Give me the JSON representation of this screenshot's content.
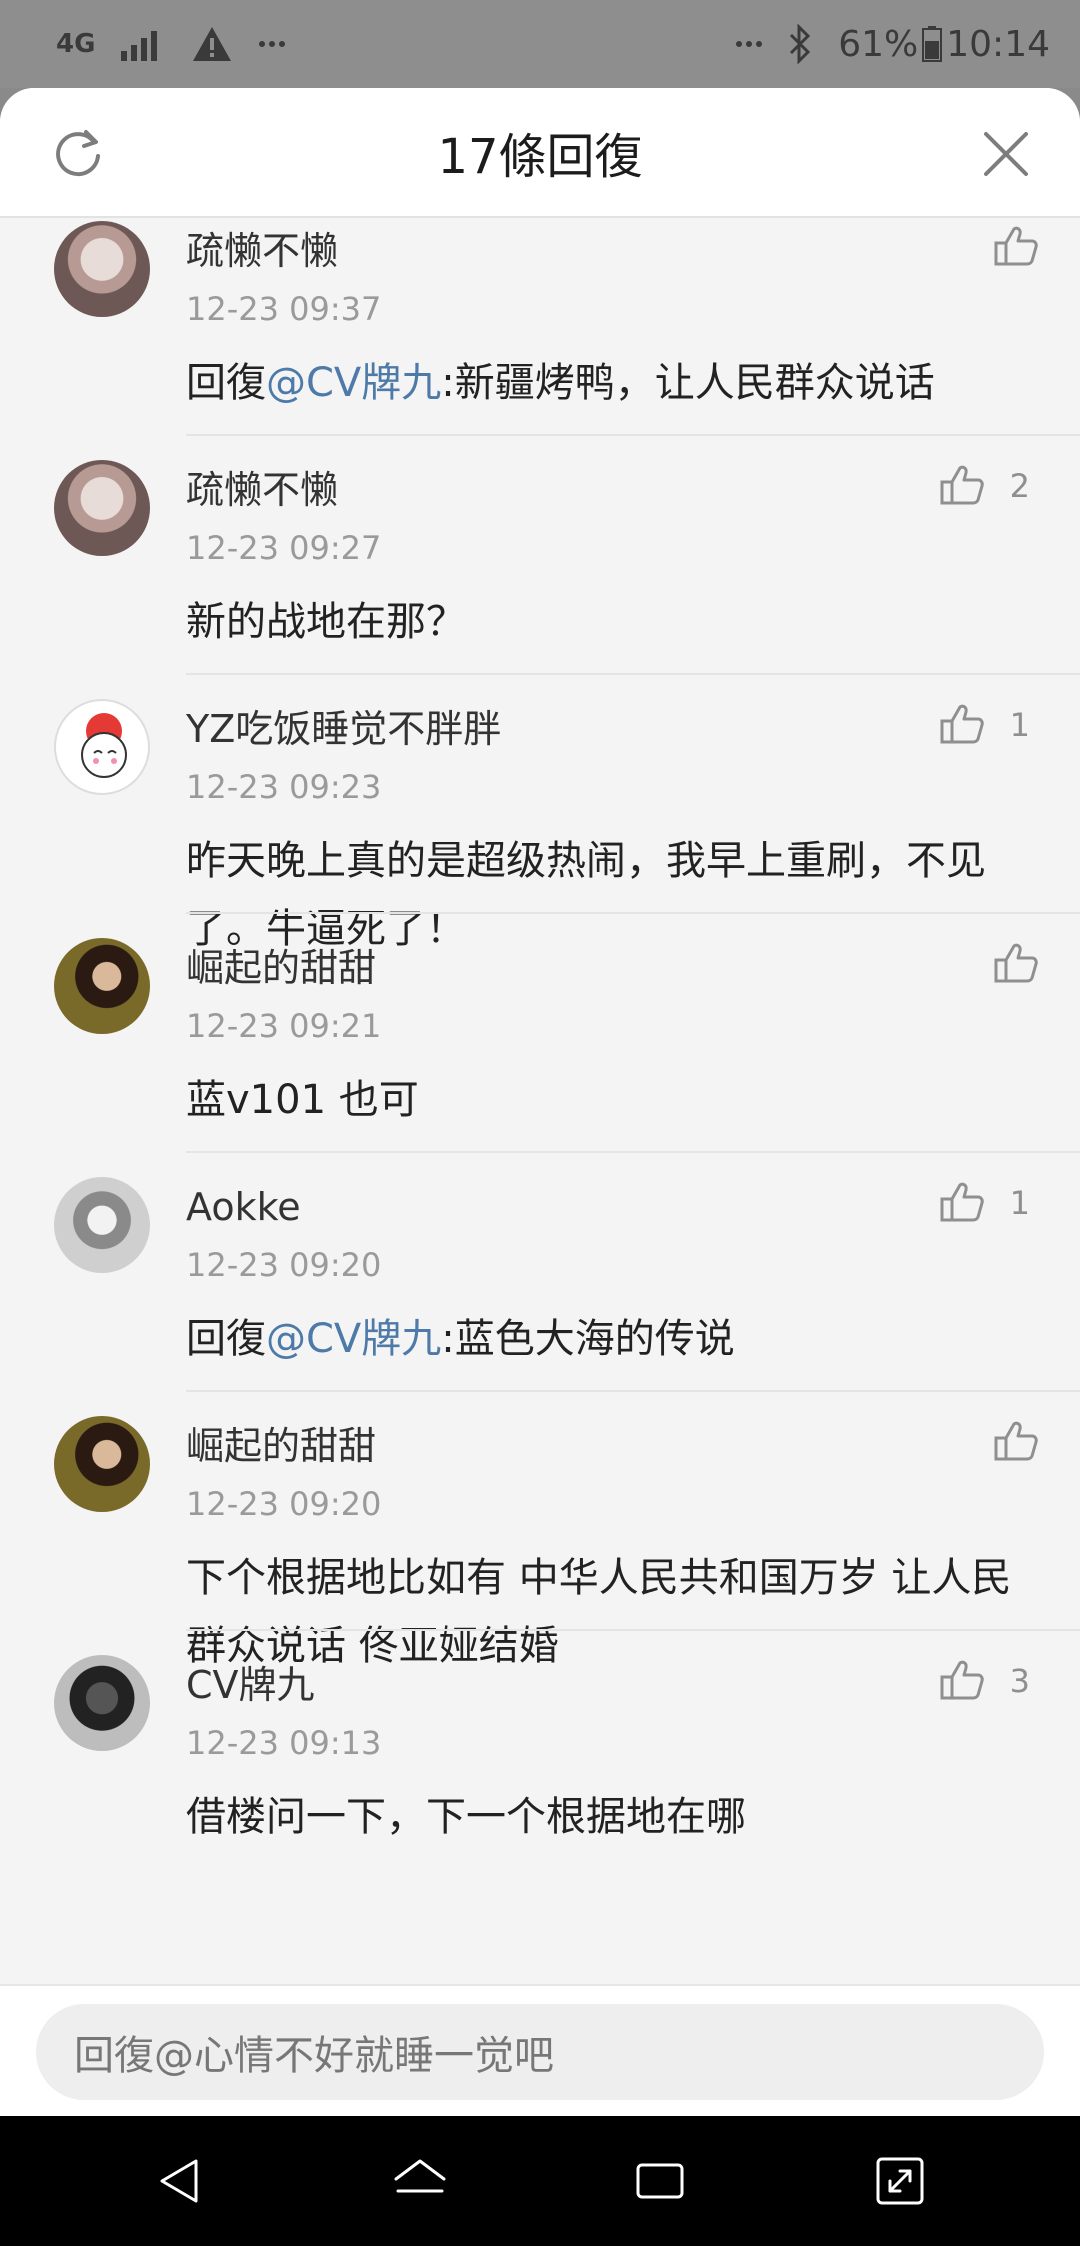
{
  "status_bar": {
    "network": "4G",
    "battery": "61%",
    "time": "10:14",
    "icons": [
      "signal-icon",
      "warning-icon",
      "more-icon",
      "bluetooth-icon",
      "battery-icon"
    ]
  },
  "header": {
    "title": "17條回復",
    "refresh_icon": "refresh-icon",
    "close_icon": "close-icon"
  },
  "comments": [
    {
      "user": "疏懒不懒",
      "time": "12-23 09:37",
      "reply_prefix": "回復",
      "mention": "@CV牌九",
      "text": ":新疆烤鸭，让人民群众说话",
      "likes": ""
    },
    {
      "user": "疏懒不懒",
      "time": "12-23 09:27",
      "reply_prefix": "",
      "mention": "",
      "text": "新的战地在那？",
      "likes": "2"
    },
    {
      "user": "YZ吃饭睡觉不胖胖",
      "time": "12-23 09:23",
      "reply_prefix": "",
      "mention": "",
      "text": "昨天晚上真的是超级热闹，我早上重刷，不见了。牛逼死了！",
      "likes": "1"
    },
    {
      "user": "崛起的甜甜",
      "time": "12-23 09:21",
      "reply_prefix": "",
      "mention": "",
      "text": "蓝v101 也可",
      "likes": ""
    },
    {
      "user": "Aokke",
      "time": "12-23 09:20",
      "reply_prefix": "回復",
      "mention": "@CV牌九",
      "text": ":蓝色大海的传说",
      "likes": "1"
    },
    {
      "user": "崛起的甜甜",
      "time": "12-23 09:20",
      "reply_prefix": "",
      "mention": "",
      "text": "下个根据地比如有 中华人民共和国万岁 让人民群众说话 佟亚娅结婚",
      "likes": ""
    },
    {
      "user": "CV牌九",
      "time": "12-23 09:13",
      "reply_prefix": "",
      "mention": "",
      "text": "借楼问一下，下一个根据地在哪",
      "likes": "3"
    }
  ],
  "reply_bar": {
    "placeholder": "回復@心情不好就睡一觉吧"
  },
  "nav_bar": {
    "icons": [
      "back-icon",
      "home-icon",
      "recents-icon",
      "expand-icon"
    ]
  },
  "colors": {
    "mention": "#4d7aa8",
    "background": "#f4f4f4",
    "status_bar": "#8e8e8e"
  }
}
